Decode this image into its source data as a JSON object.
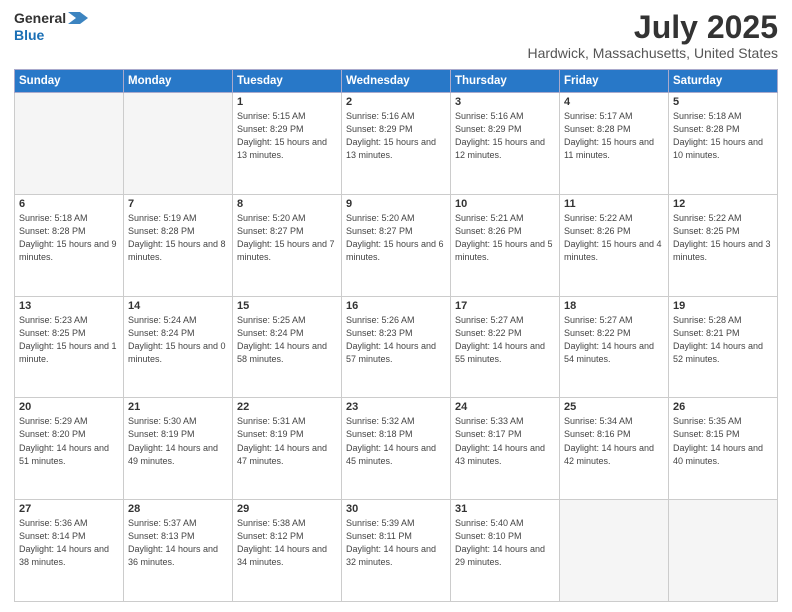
{
  "header": {
    "logo_general": "General",
    "logo_blue": "Blue",
    "title": "July 2025",
    "subtitle": "Hardwick, Massachusetts, United States"
  },
  "weekdays": [
    "Sunday",
    "Monday",
    "Tuesday",
    "Wednesday",
    "Thursday",
    "Friday",
    "Saturday"
  ],
  "weeks": [
    [
      {
        "day": "",
        "info": ""
      },
      {
        "day": "",
        "info": ""
      },
      {
        "day": "1",
        "info": "Sunrise: 5:15 AM\nSunset: 8:29 PM\nDaylight: 15 hours\nand 13 minutes."
      },
      {
        "day": "2",
        "info": "Sunrise: 5:16 AM\nSunset: 8:29 PM\nDaylight: 15 hours\nand 13 minutes."
      },
      {
        "day": "3",
        "info": "Sunrise: 5:16 AM\nSunset: 8:29 PM\nDaylight: 15 hours\nand 12 minutes."
      },
      {
        "day": "4",
        "info": "Sunrise: 5:17 AM\nSunset: 8:28 PM\nDaylight: 15 hours\nand 11 minutes."
      },
      {
        "day": "5",
        "info": "Sunrise: 5:18 AM\nSunset: 8:28 PM\nDaylight: 15 hours\nand 10 minutes."
      }
    ],
    [
      {
        "day": "6",
        "info": "Sunrise: 5:18 AM\nSunset: 8:28 PM\nDaylight: 15 hours\nand 9 minutes."
      },
      {
        "day": "7",
        "info": "Sunrise: 5:19 AM\nSunset: 8:28 PM\nDaylight: 15 hours\nand 8 minutes."
      },
      {
        "day": "8",
        "info": "Sunrise: 5:20 AM\nSunset: 8:27 PM\nDaylight: 15 hours\nand 7 minutes."
      },
      {
        "day": "9",
        "info": "Sunrise: 5:20 AM\nSunset: 8:27 PM\nDaylight: 15 hours\nand 6 minutes."
      },
      {
        "day": "10",
        "info": "Sunrise: 5:21 AM\nSunset: 8:26 PM\nDaylight: 15 hours\nand 5 minutes."
      },
      {
        "day": "11",
        "info": "Sunrise: 5:22 AM\nSunset: 8:26 PM\nDaylight: 15 hours\nand 4 minutes."
      },
      {
        "day": "12",
        "info": "Sunrise: 5:22 AM\nSunset: 8:25 PM\nDaylight: 15 hours\nand 3 minutes."
      }
    ],
    [
      {
        "day": "13",
        "info": "Sunrise: 5:23 AM\nSunset: 8:25 PM\nDaylight: 15 hours\nand 1 minute."
      },
      {
        "day": "14",
        "info": "Sunrise: 5:24 AM\nSunset: 8:24 PM\nDaylight: 15 hours\nand 0 minutes."
      },
      {
        "day": "15",
        "info": "Sunrise: 5:25 AM\nSunset: 8:24 PM\nDaylight: 14 hours\nand 58 minutes."
      },
      {
        "day": "16",
        "info": "Sunrise: 5:26 AM\nSunset: 8:23 PM\nDaylight: 14 hours\nand 57 minutes."
      },
      {
        "day": "17",
        "info": "Sunrise: 5:27 AM\nSunset: 8:22 PM\nDaylight: 14 hours\nand 55 minutes."
      },
      {
        "day": "18",
        "info": "Sunrise: 5:27 AM\nSunset: 8:22 PM\nDaylight: 14 hours\nand 54 minutes."
      },
      {
        "day": "19",
        "info": "Sunrise: 5:28 AM\nSunset: 8:21 PM\nDaylight: 14 hours\nand 52 minutes."
      }
    ],
    [
      {
        "day": "20",
        "info": "Sunrise: 5:29 AM\nSunset: 8:20 PM\nDaylight: 14 hours\nand 51 minutes."
      },
      {
        "day": "21",
        "info": "Sunrise: 5:30 AM\nSunset: 8:19 PM\nDaylight: 14 hours\nand 49 minutes."
      },
      {
        "day": "22",
        "info": "Sunrise: 5:31 AM\nSunset: 8:19 PM\nDaylight: 14 hours\nand 47 minutes."
      },
      {
        "day": "23",
        "info": "Sunrise: 5:32 AM\nSunset: 8:18 PM\nDaylight: 14 hours\nand 45 minutes."
      },
      {
        "day": "24",
        "info": "Sunrise: 5:33 AM\nSunset: 8:17 PM\nDaylight: 14 hours\nand 43 minutes."
      },
      {
        "day": "25",
        "info": "Sunrise: 5:34 AM\nSunset: 8:16 PM\nDaylight: 14 hours\nand 42 minutes."
      },
      {
        "day": "26",
        "info": "Sunrise: 5:35 AM\nSunset: 8:15 PM\nDaylight: 14 hours\nand 40 minutes."
      }
    ],
    [
      {
        "day": "27",
        "info": "Sunrise: 5:36 AM\nSunset: 8:14 PM\nDaylight: 14 hours\nand 38 minutes."
      },
      {
        "day": "28",
        "info": "Sunrise: 5:37 AM\nSunset: 8:13 PM\nDaylight: 14 hours\nand 36 minutes."
      },
      {
        "day": "29",
        "info": "Sunrise: 5:38 AM\nSunset: 8:12 PM\nDaylight: 14 hours\nand 34 minutes."
      },
      {
        "day": "30",
        "info": "Sunrise: 5:39 AM\nSunset: 8:11 PM\nDaylight: 14 hours\nand 32 minutes."
      },
      {
        "day": "31",
        "info": "Sunrise: 5:40 AM\nSunset: 8:10 PM\nDaylight: 14 hours\nand 29 minutes."
      },
      {
        "day": "",
        "info": ""
      },
      {
        "day": "",
        "info": ""
      }
    ]
  ]
}
